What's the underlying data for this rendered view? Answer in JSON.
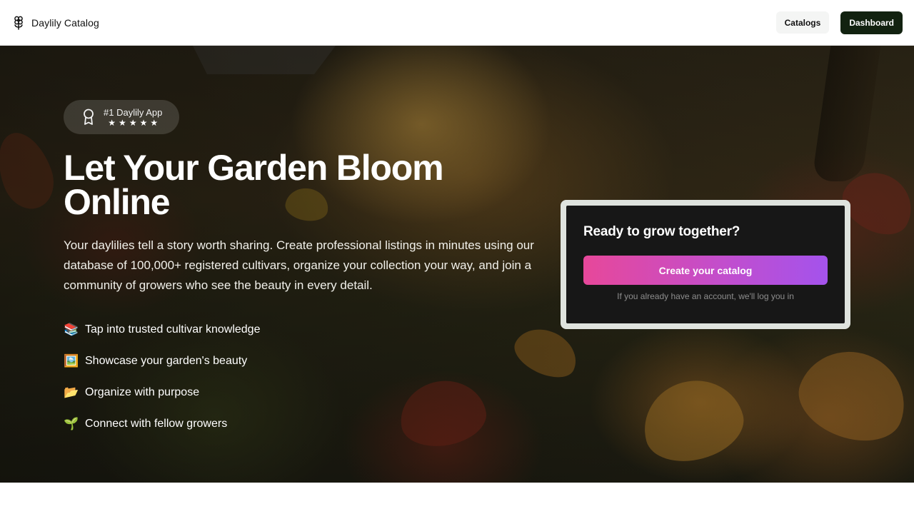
{
  "header": {
    "brand_name": "Daylily Catalog",
    "brand_icon": "flower-icon",
    "nav": {
      "catalogs_label": "Catalogs",
      "dashboard_label": "Dashboard"
    }
  },
  "hero": {
    "badge": {
      "icon": "award-ribbon-icon",
      "title": "#1 Daylily App",
      "stars": "★★★★★",
      "rating": 5
    },
    "title": "Let Your Garden Bloom Online",
    "description": "Your daylilies tell a story worth sharing. Create professional listings in minutes using our database of 100,000+ registered cultivars, organize your collection your way, and join a community of growers who see the beauty in every detail.",
    "features": [
      {
        "emoji": "📚",
        "text": "Tap into trusted cultivar knowledge"
      },
      {
        "emoji": "🖼️",
        "text": "Showcase your garden's beauty"
      },
      {
        "emoji": "📂",
        "text": "Organize with purpose"
      },
      {
        "emoji": "🌱",
        "text": "Connect with fellow growers"
      }
    ]
  },
  "cta": {
    "title": "Ready to grow together?",
    "button_label": "Create your catalog",
    "note": "If you already have an account, we'll log you in"
  },
  "colors": {
    "dashboard_bg": "#122210",
    "cta_gradient_start": "#e7489a",
    "cta_gradient_end": "#a453ec",
    "cta_card_bg": "#171717"
  }
}
